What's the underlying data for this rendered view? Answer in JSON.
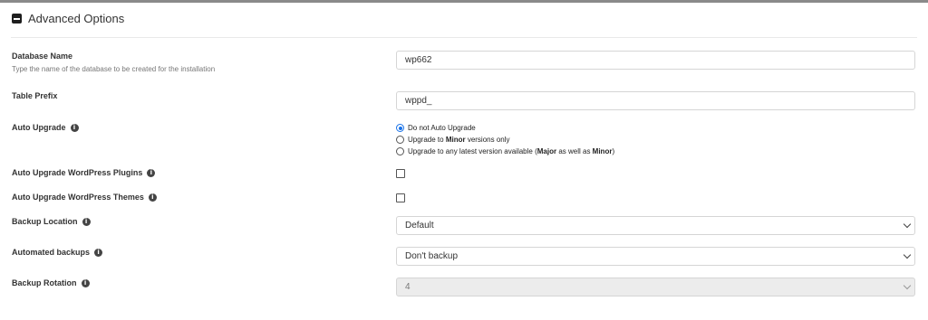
{
  "section": {
    "title": "Advanced Options"
  },
  "db_name": {
    "label": "Database Name",
    "help": "Type the name of the database to be created for the installation",
    "value": "wp662"
  },
  "table_prefix": {
    "label": "Table Prefix",
    "value": "wppd_"
  },
  "auto_upgrade": {
    "label": "Auto Upgrade",
    "options": [
      {
        "text": "Do not Auto Upgrade",
        "checked": true
      },
      {
        "pre": "Upgrade to ",
        "bold": "Minor",
        "post": " versions only",
        "checked": false
      },
      {
        "pre": "Upgrade to any latest version available (",
        "bold": "Major",
        "mid": " as well as ",
        "bold2": "Minor",
        "post": ")",
        "checked": false
      }
    ]
  },
  "auto_upgrade_plugins": {
    "label": "Auto Upgrade WordPress Plugins",
    "checked": false
  },
  "auto_upgrade_themes": {
    "label": "Auto Upgrade WordPress Themes",
    "checked": false
  },
  "backup_location": {
    "label": "Backup Location",
    "selected": "Default"
  },
  "automated_backups": {
    "label": "Automated backups",
    "selected": "Don't backup"
  },
  "backup_rotation": {
    "label": "Backup Rotation",
    "selected": "4",
    "disabled": true
  },
  "colors": {
    "accent": "#1a73e8",
    "border": "#d5d5d5",
    "disabled_bg": "#ececec"
  }
}
